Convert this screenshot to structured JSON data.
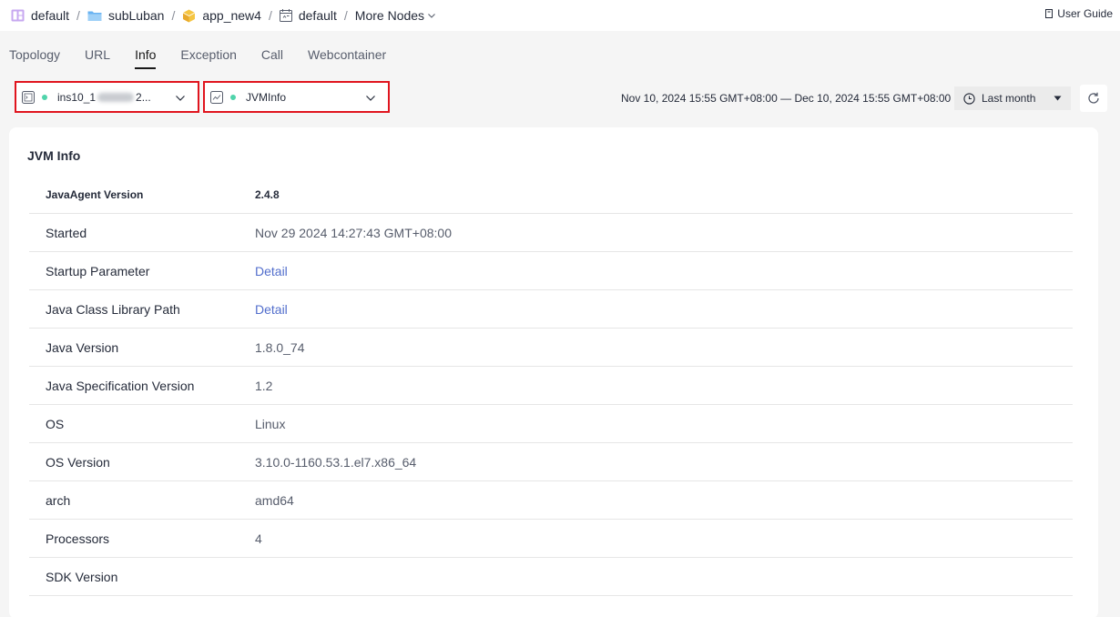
{
  "breadcrumb": {
    "items": [
      {
        "label": "default",
        "icon": "grid-icon"
      },
      {
        "label": "subLuban",
        "icon": "folder-icon"
      },
      {
        "label": "app_new4",
        "icon": "cube-icon"
      },
      {
        "label": "default",
        "icon": "environment-icon"
      }
    ],
    "more_label": "More Nodes",
    "separator": "/"
  },
  "user_guide_label": "User Guide",
  "tabs": [
    {
      "label": "Topology"
    },
    {
      "label": "URL"
    },
    {
      "label": "Info",
      "active": true
    },
    {
      "label": "Exception"
    },
    {
      "label": "Call"
    },
    {
      "label": "Webcontainer"
    }
  ],
  "filters": {
    "instance": {
      "prefix": "ins10_1",
      "suffix": "2...",
      "status_color": "#50d4ab"
    },
    "collector": {
      "value": "JVMInfo",
      "status_color": "#50d4ab"
    }
  },
  "time": {
    "range": "Nov 10, 2024 15:55 GMT+08:00 — Dec 10, 2024 15:55 GMT+08:00",
    "period": "Last month"
  },
  "panel": {
    "title": "JVM Info",
    "header": {
      "key": "JavaAgent Version",
      "value": "2.4.8"
    },
    "rows": [
      {
        "key": "Started",
        "value": "Nov 29 2024 14:27:43 GMT+08:00"
      },
      {
        "key": "Startup Parameter",
        "value": "Detail"
      },
      {
        "key": "Java Class Library Path",
        "value": "Detail"
      },
      {
        "key": "Java Version",
        "value": "1.8.0_74"
      },
      {
        "key": "Java Specification Version",
        "value": "1.2"
      },
      {
        "key": "OS",
        "value": "Linux"
      },
      {
        "key": "OS Version",
        "value": "3.10.0-1160.53.1.el7.x86_64"
      },
      {
        "key": "arch",
        "value": "amd64"
      },
      {
        "key": "Processors",
        "value": "4"
      },
      {
        "key": "SDK Version",
        "value": ""
      }
    ]
  },
  "colors": {
    "alert_border": "#e0141e",
    "link": "#526ecc",
    "status_dot": "#50d4ab"
  }
}
